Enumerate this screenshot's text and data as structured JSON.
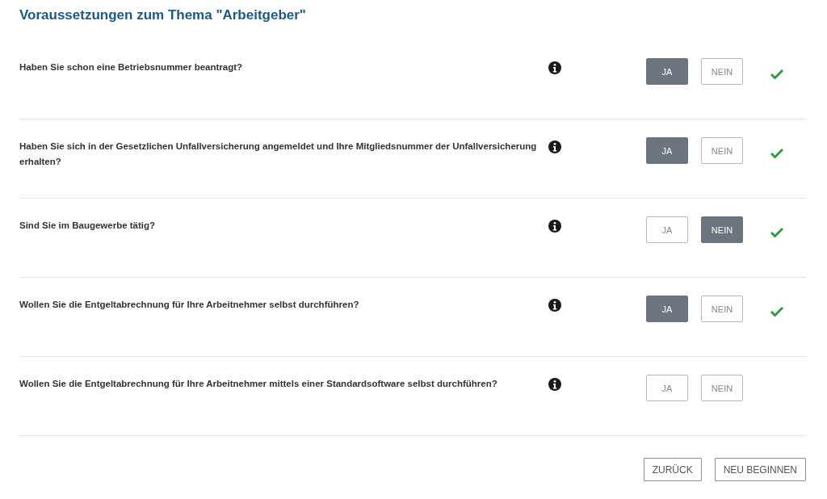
{
  "title": "Voraussetzungen zum Thema \"Arbeitgeber\"",
  "questions": [
    {
      "text": "Haben Sie schon eine Betriebsnummer beantragt?",
      "options": [
        {
          "label": "JA",
          "selected": true
        },
        {
          "label": "NEIN",
          "selected": false
        }
      ],
      "answered": true
    },
    {
      "text": "Haben Sie sich in der Gesetzlichen Unfallversicherung angemeldet und Ihre Mitgliedsnummer der Unfallversicherung erhalten?",
      "options": [
        {
          "label": "JA",
          "selected": true
        },
        {
          "label": "NEIN",
          "selected": false
        }
      ],
      "answered": true
    },
    {
      "text": "Sind Sie im Baugewerbe tätig?",
      "options": [
        {
          "label": "JA",
          "selected": false
        },
        {
          "label": "NEIN",
          "selected": true
        }
      ],
      "answered": true
    },
    {
      "text": "Wollen Sie die Entgeltabrechnung für Ihre Arbeitnehmer selbst durchführen?",
      "options": [
        {
          "label": "JA",
          "selected": true
        },
        {
          "label": "NEIN",
          "selected": false
        }
      ],
      "answered": true
    },
    {
      "text": "Wollen Sie die Entgeltabrechnung für Ihre Arbeitnehmer mittels einer Standardsoftware selbst durchführen?",
      "options": [
        {
          "label": "JA",
          "selected": false
        },
        {
          "label": "NEIN",
          "selected": false
        }
      ],
      "answered": false
    }
  ],
  "buttons": [
    "ZURÜCK",
    "NEU BEGINNEN"
  ]
}
